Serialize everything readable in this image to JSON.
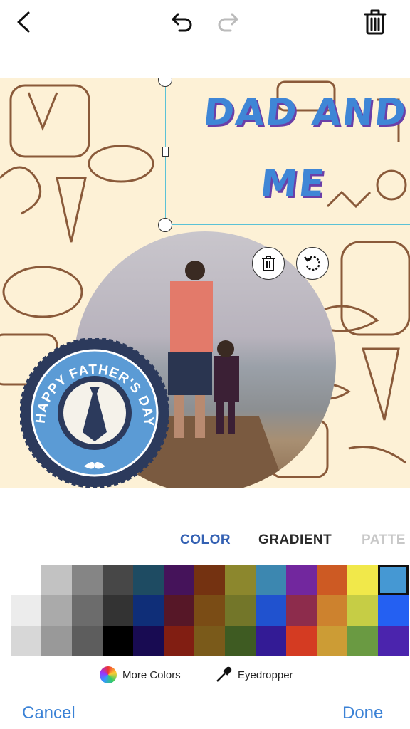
{
  "toolbar": {
    "back_icon": "chevron-left-icon",
    "undo_icon": "undo-icon",
    "redo_icon": "redo-icon",
    "delete_icon": "trash-icon"
  },
  "canvas": {
    "text_line1": "DAD AND",
    "text_line2": "ME",
    "badge_text": "HAPPY FATHER'S DAY",
    "badge_colors": {
      "ring": "#2c3a5c",
      "inner": "#5b9bd5"
    }
  },
  "tabs": [
    {
      "label": "COLOR",
      "active": true
    },
    {
      "label": "GRADIENT",
      "active": false
    },
    {
      "label": "PATTE",
      "active": false
    }
  ],
  "palette": {
    "rows": [
      [
        "#ffffff",
        "#c2c2c2",
        "#858585",
        "#474747",
        "#1e4b62",
        "#45135a",
        "#743211",
        "#8c872d",
        "#3c87b0",
        "#72279e",
        "#cd5a23",
        "#f1e84a",
        "#4598d3"
      ],
      [
        "#ececec",
        "#aaaaaa",
        "#6c6c6c",
        "#333333",
        "#0f2e78",
        "#561727",
        "#7a4c15",
        "#737629",
        "#2052cf",
        "#8d2c4c",
        "#cd822e",
        "#c6cd45",
        "#2460f2"
      ],
      [
        "#d7d7d7",
        "#999999",
        "#5d5d5d",
        "#000000",
        "#180b52",
        "#811e12",
        "#7a5a1a",
        "#3e5b22",
        "#331b95",
        "#d43b22",
        "#cc9c35",
        "#6a9a42",
        "#4b24ad"
      ]
    ],
    "selected": "#4598d3"
  },
  "tools": {
    "more_colors": "More Colors",
    "eyedropper": "Eyedropper"
  },
  "footer": {
    "cancel": "Cancel",
    "done": "Done"
  }
}
